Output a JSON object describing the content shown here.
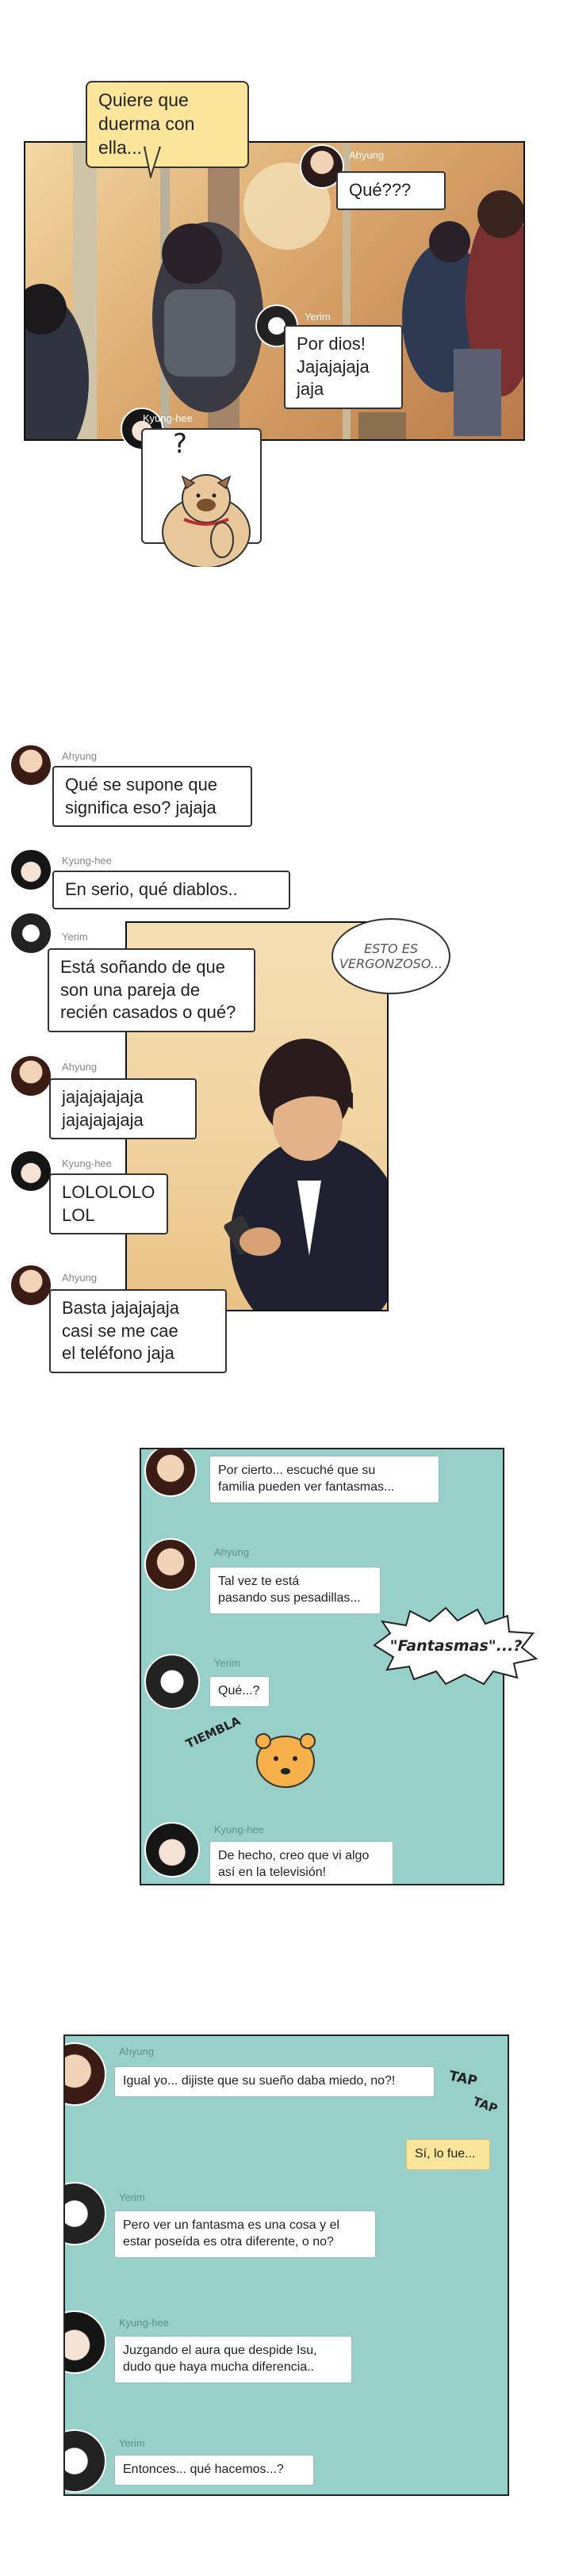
{
  "panel1": {
    "narration": "Quiere que\nduerma con ella...",
    "msg1": {
      "name": "Ahyung",
      "text": "Qué???"
    },
    "msg2": {
      "name": "Yerim",
      "text": "Por dios!\nJajajajaja\njaja"
    },
    "msg3": {
      "name": "Kyung-hee",
      "text": "?"
    }
  },
  "chat1": {
    "m1": {
      "name": "Ahyung",
      "text": "Qué se supone que\nsignifica eso? jajaja"
    },
    "m2": {
      "name": "Kyung-hee",
      "text": "En serio, qué diablos.."
    },
    "m3": {
      "name": "Yerim",
      "text": "Está soñando de que\nson una pareja de\nrecién casados o qué?"
    },
    "m4": {
      "name": "Ahyung",
      "text": "jajajajajaja\njajajajajaja"
    },
    "m5": {
      "name": "Kyung-hee",
      "text": "LOLOLOLO\nLOL"
    },
    "m6": {
      "name": "Ahyung",
      "text": "Basta jajajajaja\ncasi se me cae\nel teléfono jaja"
    },
    "thought": "ESTO ES\nVERGONZOSO..."
  },
  "chat2": {
    "m1": {
      "text": "Por cierto... escuché que su\nfamilia pueden ver fantasmas..."
    },
    "m2": {
      "name": "Ahyung",
      "text": "Tal vez te está\npasando sus pesadillas..."
    },
    "m3": {
      "name": "Yerim",
      "text": "Qué...?"
    },
    "m4": {
      "name": "Kyung-hee",
      "text": "De hecho, creo que vi algo\nasí en la televisión!"
    },
    "shout": "\"Fantasmas\"...?",
    "sfx": "TIEMBLA"
  },
  "chat3": {
    "m1": {
      "name": "Ahyung",
      "text": "Igual yo... dijiste que su sueño daba miedo, no?!"
    },
    "reply": "Sí, lo fue...",
    "m2": {
      "name": "Yerim",
      "text": "Pero ver un fantasma es una cosa y el\nestar poseída es otra diferente, o no?"
    },
    "m3": {
      "name": "Kyung-hee",
      "text": "Juzgando el aura que despide Isu,\ndudo que haya mucha diferencia.."
    },
    "m4": {
      "name": "Yerim",
      "text": "Entonces... qué hacemos...?"
    },
    "sfx1": "TAP",
    "sfx2": "TAP"
  },
  "colors": {
    "chat_bg": "#97cfc9",
    "highlight": "#fbe59a",
    "train_warm": "#d9a56a"
  }
}
